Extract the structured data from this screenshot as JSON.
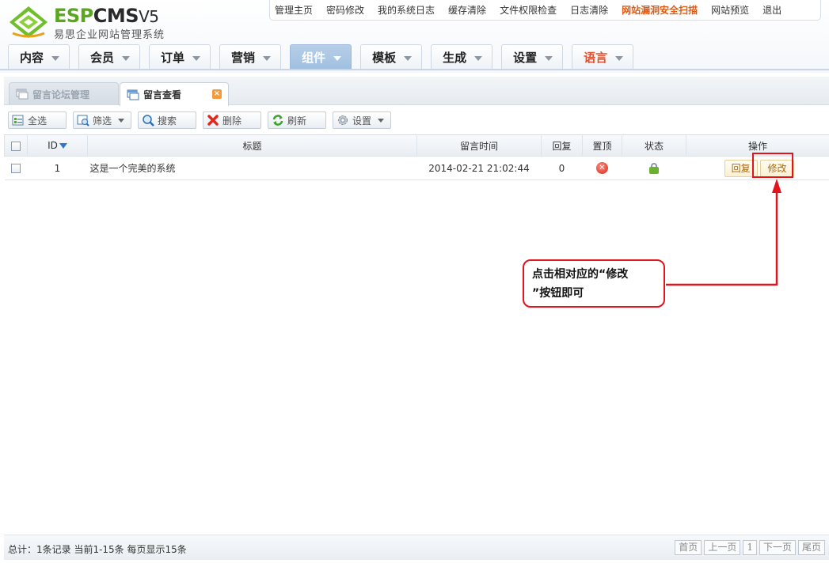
{
  "logo": {
    "brand_a": "ESP",
    "brand_b": "CMS",
    "brand_version": "V5",
    "subtitle": "易思企业网站管理系统"
  },
  "topnav": [
    {
      "label": "管理主页"
    },
    {
      "label": "密码修改"
    },
    {
      "label": "我的系统日志"
    },
    {
      "label": "缓存清除"
    },
    {
      "label": "文件权限检查"
    },
    {
      "label": "日志清除"
    },
    {
      "label": "网站漏洞安全扫描",
      "highlight": true
    },
    {
      "label": "网站预览"
    },
    {
      "label": "退出"
    }
  ],
  "mainmenu": [
    {
      "label": "内容"
    },
    {
      "label": "会员"
    },
    {
      "label": "订单"
    },
    {
      "label": "营销"
    },
    {
      "label": "组件",
      "active": true
    },
    {
      "label": "模板"
    },
    {
      "label": "生成"
    },
    {
      "label": "设置"
    },
    {
      "label": "语言"
    }
  ],
  "tabs": {
    "tab1": "留言论坛管理",
    "tab2": "留言查看"
  },
  "toolbar": {
    "select_all": "全选",
    "filter": "筛选",
    "search": "搜索",
    "delete": "删除",
    "refresh": "刷新",
    "settings": "设置"
  },
  "table": {
    "headers": {
      "id": "ID",
      "title": "标题",
      "time": "留言时间",
      "replies": "回复",
      "pinned": "置顶",
      "status": "状态",
      "actions": "操作"
    },
    "rows": [
      {
        "id": "1",
        "title": "这是一个完美的系统",
        "time": "2014-02-21 21:02:44",
        "replies": "0",
        "reply_btn": "回复",
        "edit_btn": "修改"
      }
    ]
  },
  "callout": {
    "line1": "点击相对应的“修改",
    "line2": "”按钮即可"
  },
  "footer": {
    "info": "总计：1条记录 当前1-15条 每页显示15条",
    "pager": {
      "first": "首页",
      "prev": "上一页",
      "current": "1",
      "next": "下一页",
      "last": "尾页"
    }
  },
  "colors": {
    "accent_red": "#e3141b",
    "brand_green": "#5aa61e",
    "active_menu": "#9fbfe0"
  }
}
